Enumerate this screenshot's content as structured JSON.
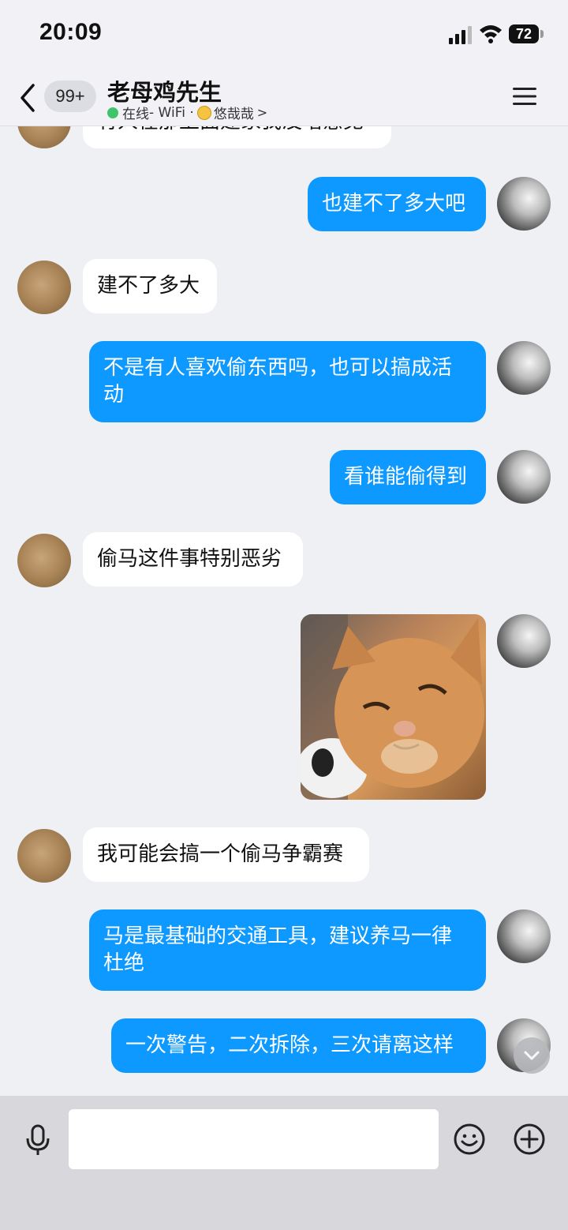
{
  "status_bar": {
    "time": "20:09",
    "battery": "72"
  },
  "header": {
    "unread_count": "99+",
    "contact_name": "老母鸡先生",
    "online": "在线",
    "network": " - WiFi · ",
    "mood": "悠哉哉",
    "chevron": ">"
  },
  "messages": [
    {
      "side": "in",
      "text": "有人在那上面建家我没啥意见"
    },
    {
      "side": "out",
      "text": "也建不了多大吧"
    },
    {
      "side": "in",
      "text": "建不了多大"
    },
    {
      "side": "out",
      "text": "不是有人喜欢偷东西吗，也可以搞成活动"
    },
    {
      "side": "out",
      "text": "看谁能偷得到"
    },
    {
      "side": "in",
      "text": "偷马这件事特别恶劣"
    },
    {
      "side": "out",
      "type": "sticker",
      "text": ""
    },
    {
      "side": "in",
      "text": "我可能会搞一个偷马争霸赛"
    },
    {
      "side": "out",
      "text": "马是最基础的交通工具，建议养马一律杜绝"
    },
    {
      "side": "out",
      "text": "一次警告，二次拆除，三次请离这样"
    }
  ],
  "input": {
    "placeholder": ""
  },
  "colors": {
    "bubble_out": "#0d99ff",
    "bubble_in": "#ffffff",
    "online": "#3ec56b"
  }
}
